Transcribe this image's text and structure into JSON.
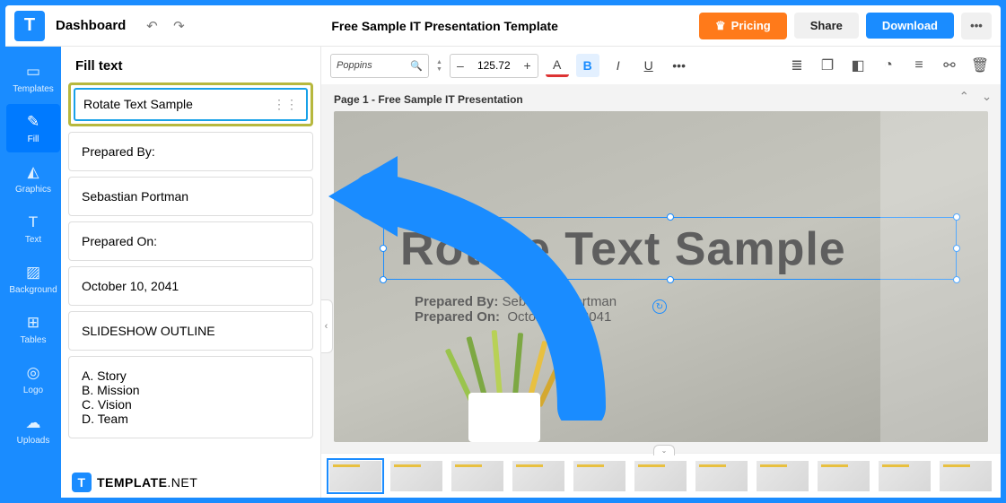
{
  "topbar": {
    "page": "Dashboard",
    "title": "Free Sample IT Presentation Template",
    "pricing": "Pricing",
    "share": "Share",
    "download": "Download"
  },
  "sidebar": {
    "items": [
      {
        "label": "Templates"
      },
      {
        "label": "Fill"
      },
      {
        "label": "Graphics"
      },
      {
        "label": "Text"
      },
      {
        "label": "Background"
      },
      {
        "label": "Tables"
      },
      {
        "label": "Logo"
      },
      {
        "label": "Uploads"
      }
    ]
  },
  "fillPanel": {
    "header": "Fill text",
    "items": [
      "Rotate Text Sample",
      "Prepared By:",
      "Sebastian Portman",
      "Prepared On:",
      "October 10, 2041",
      "SLIDESHOW OUTLINE",
      "A. Story\nB. Mission\nC. Vision\nD. Team"
    ],
    "brand": "TEMPLATE",
    "brandSuffix": ".NET"
  },
  "toolbar": {
    "font": "Poppins",
    "size": "125.72",
    "minus": "–",
    "plus": "+",
    "colorLetter": "A",
    "bold": "B",
    "italic": "I",
    "underline": "U"
  },
  "canvas": {
    "pageLabel": "Page 1 - Free Sample IT Presentation",
    "bigTitle": "Rotate Text Sample",
    "preparedByLabel": "Prepared By:",
    "preparedByValue": "Sebastian Portman",
    "preparedOnLabel": "Prepared On:",
    "preparedOnValue": "October 10, 2041"
  }
}
